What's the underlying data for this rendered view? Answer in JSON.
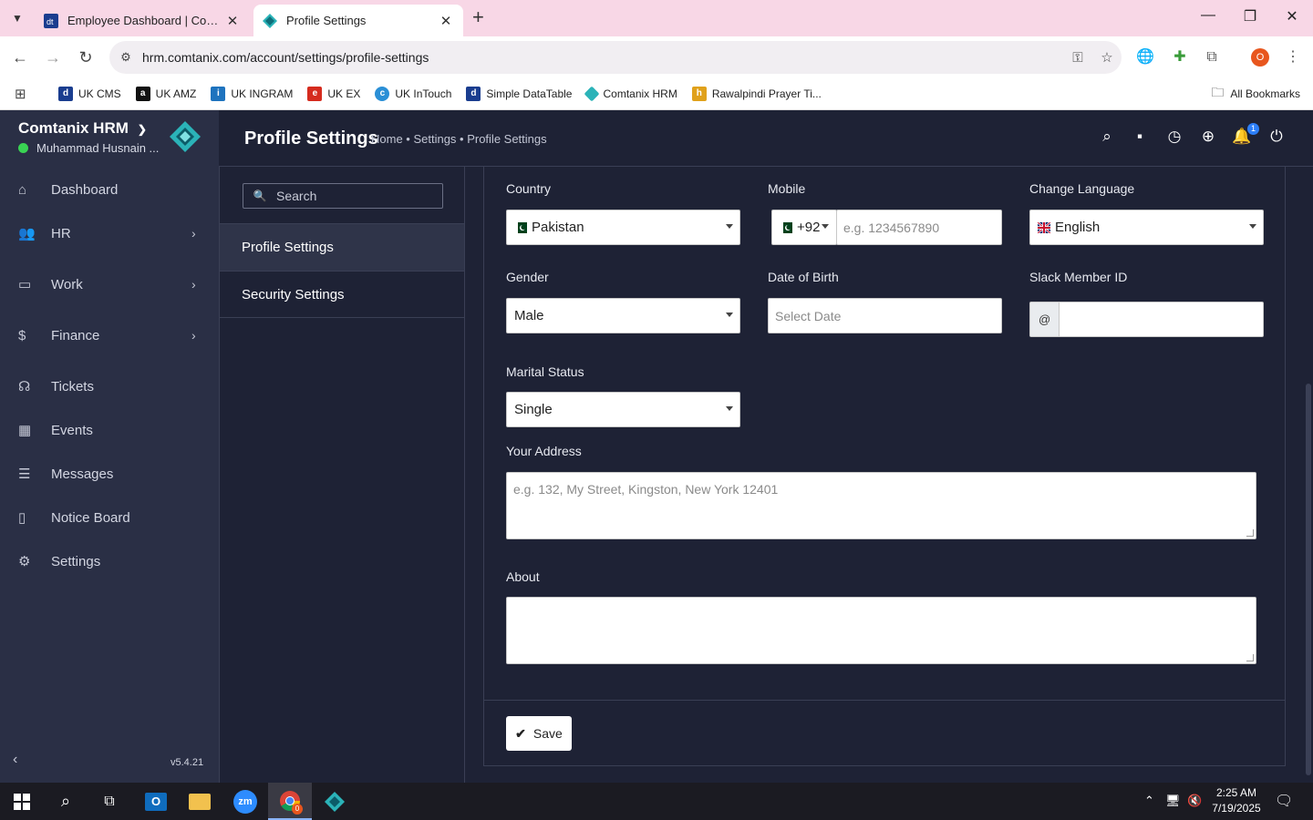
{
  "browser": {
    "tabs": [
      {
        "title": "Employee Dashboard | Comtanix",
        "active": false
      },
      {
        "title": "Profile Settings",
        "active": true
      }
    ],
    "url": "hrm.comtanix.com/account/settings/profile-settings",
    "profile_initial": "O",
    "bookmarks": [
      {
        "label": "UK CMS",
        "icon_color": "#1a3d8f"
      },
      {
        "label": "UK AMZ",
        "icon_color": "#111111"
      },
      {
        "label": "UK INGRAM",
        "icon_color": "#1e73be"
      },
      {
        "label": "UK EX",
        "icon_color": "#d52b1e"
      },
      {
        "label": "UK InTouch",
        "icon_color": "#2a8fd6"
      },
      {
        "label": "Simple DataTable",
        "icon_color": "#1a3d8f"
      },
      {
        "label": "Comtanix HRM",
        "icon_color": "#2bb3b8"
      },
      {
        "label": "Rawalpindi Prayer Ti...",
        "icon_color": "#e0a11b"
      }
    ],
    "all_bookmarks": "All Bookmarks"
  },
  "sidebar": {
    "brand": "Comtanix HRM",
    "user": "Muhammad Husnain ...",
    "status_color": "#39d353",
    "items": [
      {
        "label": "Dashboard",
        "icon": "home-icon",
        "has_arrow": false
      },
      {
        "label": "HR",
        "icon": "users-icon",
        "has_arrow": true
      },
      {
        "label": "Work",
        "icon": "briefcase-icon",
        "has_arrow": true
      },
      {
        "label": "Finance",
        "icon": "dollar-icon",
        "has_arrow": true
      },
      {
        "label": "Tickets",
        "icon": "headset-icon",
        "has_arrow": false
      },
      {
        "label": "Events",
        "icon": "calendar-icon",
        "has_arrow": false
      },
      {
        "label": "Messages",
        "icon": "message-icon",
        "has_arrow": false
      },
      {
        "label": "Notice Board",
        "icon": "clipboard-icon",
        "has_arrow": false
      },
      {
        "label": "Settings",
        "icon": "gear-icon",
        "has_arrow": false
      }
    ],
    "version": "v5.4.21"
  },
  "header": {
    "title": "Profile Settings",
    "breadcrumb": "Home • Settings • Profile Settings",
    "notification_count": "1"
  },
  "settings_nav": {
    "search_placeholder": "Search",
    "items": [
      {
        "label": "Profile Settings",
        "active": true
      },
      {
        "label": "Security Settings",
        "active": false
      }
    ]
  },
  "form": {
    "country": {
      "label": "Country",
      "value": "Pakistan"
    },
    "mobile": {
      "label": "Mobile",
      "code": "+92",
      "placeholder": "e.g. 1234567890"
    },
    "language": {
      "label": "Change Language",
      "value": "English"
    },
    "gender": {
      "label": "Gender",
      "value": "Male"
    },
    "dob": {
      "label": "Date of Birth",
      "placeholder": "Select Date"
    },
    "slack": {
      "label": "Slack Member ID",
      "prefix": "@"
    },
    "marital": {
      "label": "Marital Status",
      "value": "Single"
    },
    "address": {
      "label": "Your Address",
      "placeholder": "e.g. 132, My Street, Kingston, New York 12401"
    },
    "about": {
      "label": "About"
    },
    "save_label": "Save"
  },
  "taskbar": {
    "time": "2:25 AM",
    "date": "7/19/2025",
    "chrome_badge": "0"
  },
  "colors": {
    "app_bg": "#1e2235",
    "sidebar_bg": "#2a2f45",
    "accent": "#2d7ff9",
    "tab_strip": "#f8d7e6"
  }
}
